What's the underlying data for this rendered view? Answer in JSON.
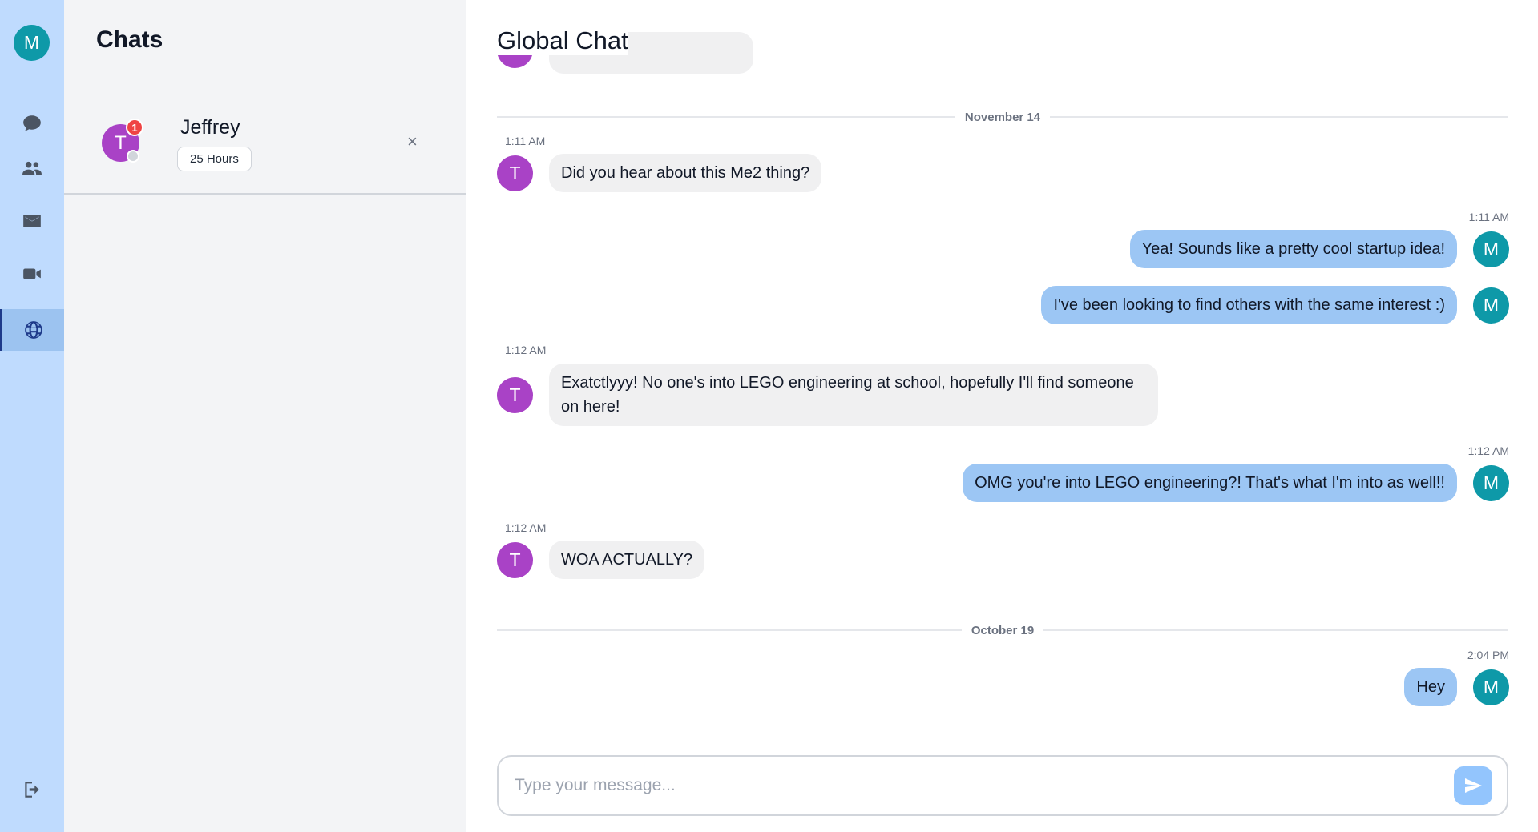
{
  "user": {
    "avatar_initial": "M"
  },
  "rail": {
    "items": [
      {
        "icon": "chat-bubble-icon"
      },
      {
        "icon": "people-icon"
      },
      {
        "icon": "mail-icon"
      },
      {
        "icon": "video-camera-icon"
      },
      {
        "icon": "globe-icon",
        "active": true
      }
    ],
    "logout_icon": "logout-icon"
  },
  "chats_panel": {
    "title": "Chats",
    "items": [
      {
        "initial": "T",
        "name": "Jeffrey",
        "tag": "25 Hours",
        "unread": "1",
        "close": "×"
      }
    ]
  },
  "main": {
    "title": "Global Chat",
    "dates": [
      "November 14",
      "October 19"
    ],
    "messages": [
      {
        "dir": "in",
        "time": "1:11 AM",
        "initial": "T",
        "text": "Did you hear about this Me2 thing?"
      },
      {
        "dir": "out",
        "time": "1:11 AM",
        "initial": "M",
        "text": "Yea! Sounds like a pretty cool startup idea!"
      },
      {
        "dir": "out",
        "time": "",
        "initial": "M",
        "text": "I've been looking to find others with the same interest :)"
      },
      {
        "dir": "in",
        "time": "1:12 AM",
        "initial": "T",
        "text": "Exatctlyyy! No one's into LEGO engineering at school, hopefully I'll find someone on here!"
      },
      {
        "dir": "out",
        "time": "1:12 AM",
        "initial": "M",
        "text": "OMG you're into LEGO engineering?! That's what I'm into as well!!"
      },
      {
        "dir": "in",
        "time": "1:12 AM",
        "initial": "T",
        "text": "WOA ACTUALLY?"
      },
      {
        "dir": "out",
        "time": "2:04 PM",
        "initial": "M",
        "text": "Hey"
      }
    ]
  },
  "composer": {
    "placeholder": "Type your message...",
    "value": ""
  },
  "colors": {
    "rail_bg": "#bfdbfe",
    "incoming_avatar": "#a942c6",
    "outgoing_avatar": "#0e99a8",
    "outgoing_bubble": "#9cc6f4",
    "incoming_bubble": "#f0f0f1"
  }
}
